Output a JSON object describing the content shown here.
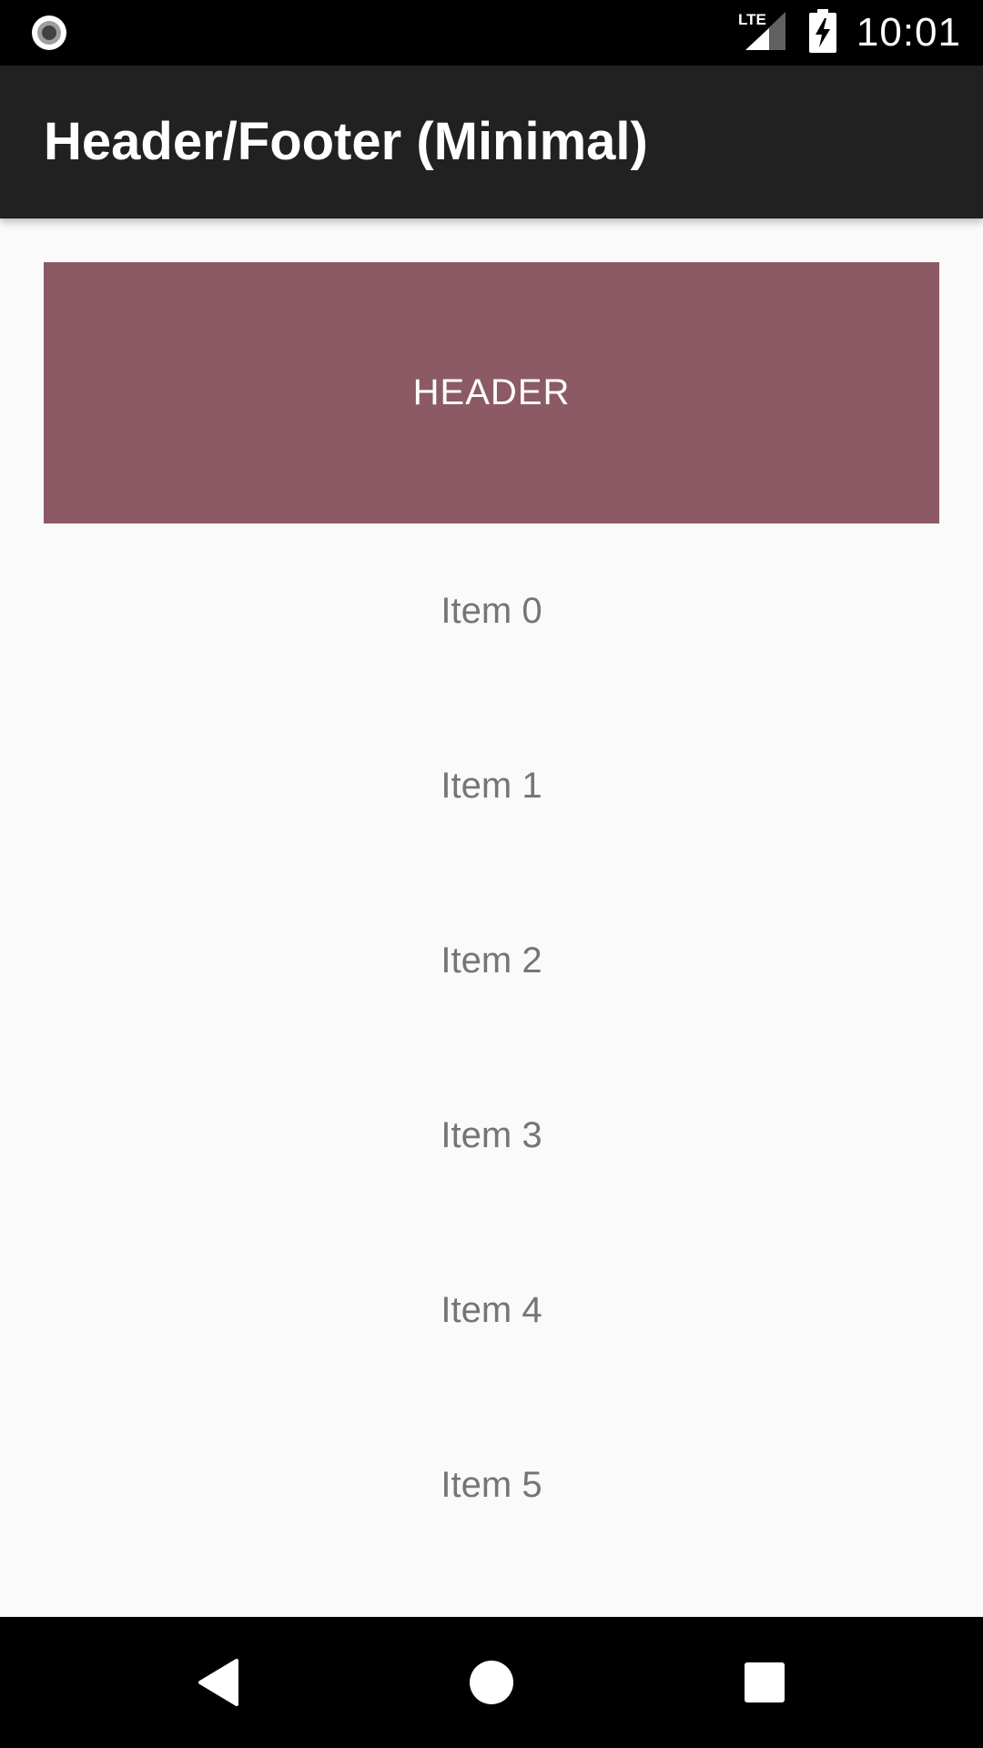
{
  "status_bar": {
    "left_icon": "radio-record-icon",
    "network": "LTE",
    "signal_icon": "signal-icon",
    "battery_icon": "battery-charging-icon",
    "time": "10:01"
  },
  "app_bar": {
    "title": "Header/Footer (Minimal)",
    "background": "#212121"
  },
  "header": {
    "label": "HEADER",
    "background": "#8b5a65"
  },
  "list": {
    "items": [
      {
        "label": "Item 0"
      },
      {
        "label": "Item 1"
      },
      {
        "label": "Item 2"
      },
      {
        "label": "Item 3"
      },
      {
        "label": "Item 4"
      },
      {
        "label": "Item 5"
      }
    ]
  },
  "nav_bar": {
    "back_icon": "back-triangle-icon",
    "home_icon": "home-circle-icon",
    "recents_icon": "recents-square-icon"
  }
}
